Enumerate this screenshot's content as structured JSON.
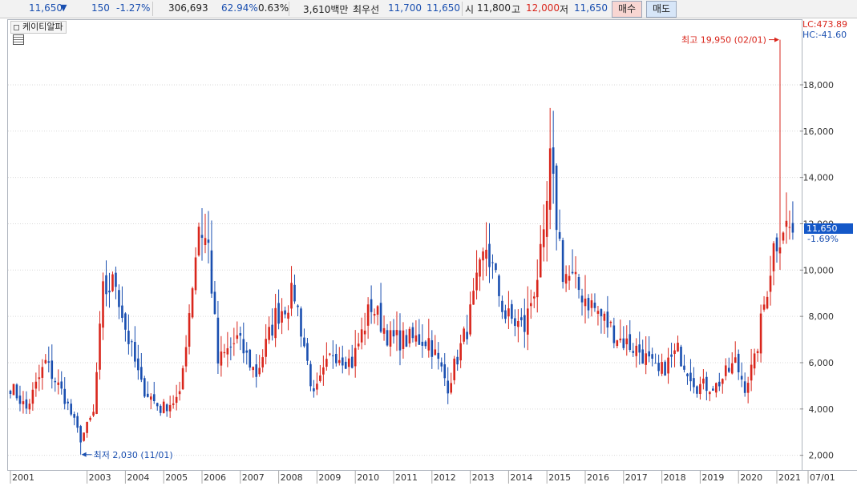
{
  "header": {
    "price": "11,650",
    "down_icon": "down-triangle",
    "change": "150",
    "change_pct": "-1.27%",
    "volume": "306,693",
    "ratio1": "62.94%",
    "ratio2": "0.63%",
    "amount": "3,610백만",
    "best_quote_label": "최우선",
    "best_ask": "11,700",
    "best_bid": "11,650",
    "open_label": "시",
    "open": "11,800",
    "high_label": "고",
    "high": "12,000",
    "low_label": "저",
    "low": "11,650",
    "buy_label": "매수",
    "sell_label": "매도"
  },
  "chart_title": "케이티알파",
  "price_tag": "11,650",
  "price_tag_pct": "-1.69%",
  "lc_label": "LC:473.89",
  "hc_label": "HC:-41.60",
  "colors": {
    "up": "#d9261c",
    "down": "#1a4fb0",
    "grid": "#d9d9d9"
  },
  "chart_data": {
    "type": "candlestick",
    "period": "monthly",
    "x_labels": [
      "2001",
      "2003",
      "2004",
      "2005",
      "2006",
      "2007",
      "2008",
      "2009",
      "2010",
      "2011",
      "2012",
      "2013",
      "2014",
      "2015",
      "2016",
      "2017",
      "2018",
      "2019",
      "2020",
      "2021",
      "07/01"
    ],
    "y_ticks": [
      2000,
      4000,
      6000,
      8000,
      10000,
      12000,
      14000,
      16000,
      18000
    ],
    "y_tick_labels": [
      "2,000",
      "4,000",
      "6,000",
      "8,000",
      "10,000",
      "12,000",
      "14,000",
      "16,000",
      "18,000"
    ],
    "ylim": [
      1400,
      20800
    ],
    "points": [
      {
        "x": "2001-01",
        "close": 5000
      },
      {
        "x": "2001-06",
        "close": 4000
      },
      {
        "x": "2001-12",
        "close": 6000
      },
      {
        "x": "2002-06",
        "close": 4500
      },
      {
        "x": "2002-11",
        "close": 2700
      },
      {
        "x": "2003-03",
        "close": 3800
      },
      {
        "x": "2003-06",
        "close": 9000
      },
      {
        "x": "2003-10",
        "close": 9500
      },
      {
        "x": "2004-01",
        "close": 7500
      },
      {
        "x": "2004-06",
        "close": 5000
      },
      {
        "x": "2004-12",
        "close": 4000
      },
      {
        "x": "2005-06",
        "close": 4500
      },
      {
        "x": "2005-12",
        "close": 12000
      },
      {
        "x": "2006-03",
        "close": 11000
      },
      {
        "x": "2006-06",
        "close": 6000
      },
      {
        "x": "2006-12",
        "close": 7000
      },
      {
        "x": "2007-06",
        "close": 5500
      },
      {
        "x": "2007-12",
        "close": 8000
      },
      {
        "x": "2008-06",
        "close": 9000
      },
      {
        "x": "2008-12",
        "close": 4500
      },
      {
        "x": "2009-06",
        "close": 6500
      },
      {
        "x": "2009-12",
        "close": 6000
      },
      {
        "x": "2010-06",
        "close": 8500
      },
      {
        "x": "2010-12",
        "close": 7000
      },
      {
        "x": "2011-06",
        "close": 7000
      },
      {
        "x": "2011-12",
        "close": 7000
      },
      {
        "x": "2012-06",
        "close": 5000
      },
      {
        "x": "2012-12",
        "close": 7500
      },
      {
        "x": "2013-06",
        "close": 11000
      },
      {
        "x": "2013-12",
        "close": 8000
      },
      {
        "x": "2014-06",
        "close": 7500
      },
      {
        "x": "2014-12",
        "close": 11000
      },
      {
        "x": "2015-02",
        "close": 14500
      },
      {
        "x": "2015-06",
        "close": 10000
      },
      {
        "x": "2015-12",
        "close": 9000
      },
      {
        "x": "2016-06",
        "close": 8000
      },
      {
        "x": "2016-12",
        "close": 7000
      },
      {
        "x": "2017-06",
        "close": 6500
      },
      {
        "x": "2017-12",
        "close": 5500
      },
      {
        "x": "2018-06",
        "close": 6500
      },
      {
        "x": "2018-12",
        "close": 5000
      },
      {
        "x": "2019-06",
        "close": 5000
      },
      {
        "x": "2019-12",
        "close": 6000
      },
      {
        "x": "2020-03",
        "close": 5000
      },
      {
        "x": "2020-06",
        "close": 6000
      },
      {
        "x": "2020-12",
        "close": 11000
      },
      {
        "x": "2021-03",
        "close": 12000
      },
      {
        "x": "2021-06",
        "close": 11650
      }
    ],
    "annotations": [
      {
        "text": "최고 19,950 (02/01)",
        "x": "2021-02",
        "value": 19950
      },
      {
        "text": "최저 2,030 (11/01)",
        "x": "2002-11",
        "value": 2030
      }
    ]
  }
}
